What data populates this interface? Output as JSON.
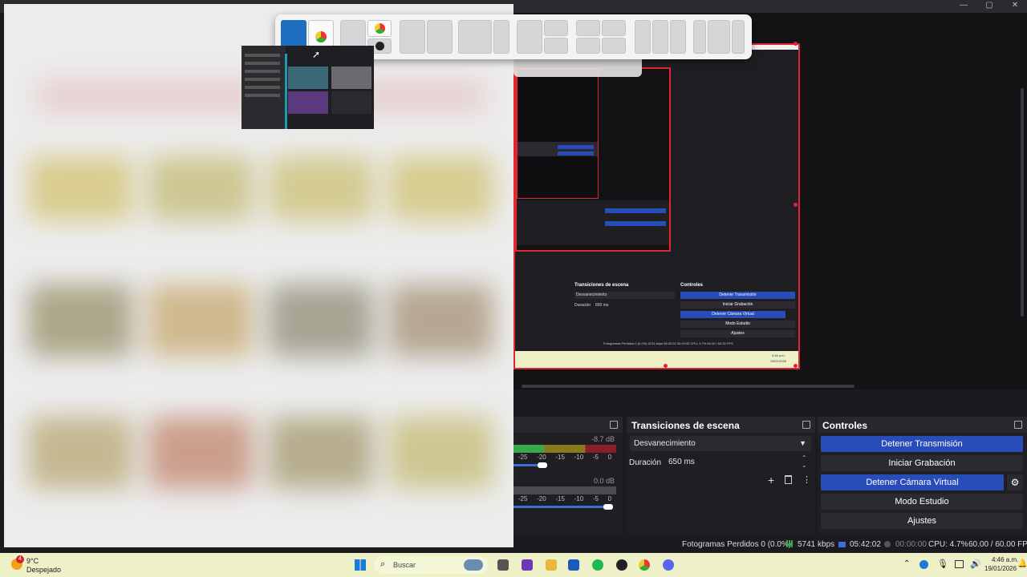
{
  "obs": {
    "dock_transitions": {
      "title": "Transiciones de escena",
      "transition": "Desvanecimiento",
      "duration_label": "Duración",
      "duration_value": "650 ms"
    },
    "dock_controls": {
      "title": "Controles",
      "buttons": [
        "Detener Transmisión",
        "Iniciar Grabación",
        "Detener Cámara Virtual",
        "Modo Estudio",
        "Ajustes"
      ]
    },
    "audio_mixer": {
      "db1": "-8.7 dB",
      "db2": "0.0 dB",
      "scale": [
        "-25",
        "-20",
        "-15",
        "-10",
        "-5",
        "0"
      ]
    },
    "status": {
      "frames_lost": "Fotogramas Perdidos 0 (0.0%)",
      "bitrate": "5741 kbps",
      "stream_time": "05:42:02",
      "rec_time": "00:00:00",
      "cpu": "CPU: 4.7%",
      "fps": "60.00 / 60.00 FPS"
    }
  },
  "nested": {
    "transitions_title": "Transiciones de escena",
    "controls_title": "Controles",
    "transition": "Desvanecimiento",
    "duration_label": "Duración",
    "duration_value": "650 ms",
    "buttons": [
      "Detener Transmisión",
      "Iniciar Grabación",
      "Detener Cámara Virtual",
      "Modo Estudio",
      "Ajustes"
    ],
    "status": "Fotogramas Perdidos 0 (0.0%)   5741 kbps   05:42:02   00:00:00   CPU: 4.7%   60.00 / 60.00 FPS",
    "clock_time": "4:46 a.m.",
    "clock_date": "19/01/2026"
  },
  "taskbar": {
    "weather_temp": "9°C",
    "weather_desc": "Despejado",
    "weather_badge": "4",
    "search_placeholder": "Buscar",
    "time": "4:46 a.m.",
    "date": "19/01/2026"
  },
  "colors": {
    "accent": "#284cb8",
    "capture_border": "#e22631",
    "taskbar_bg": "#eef0c7"
  }
}
